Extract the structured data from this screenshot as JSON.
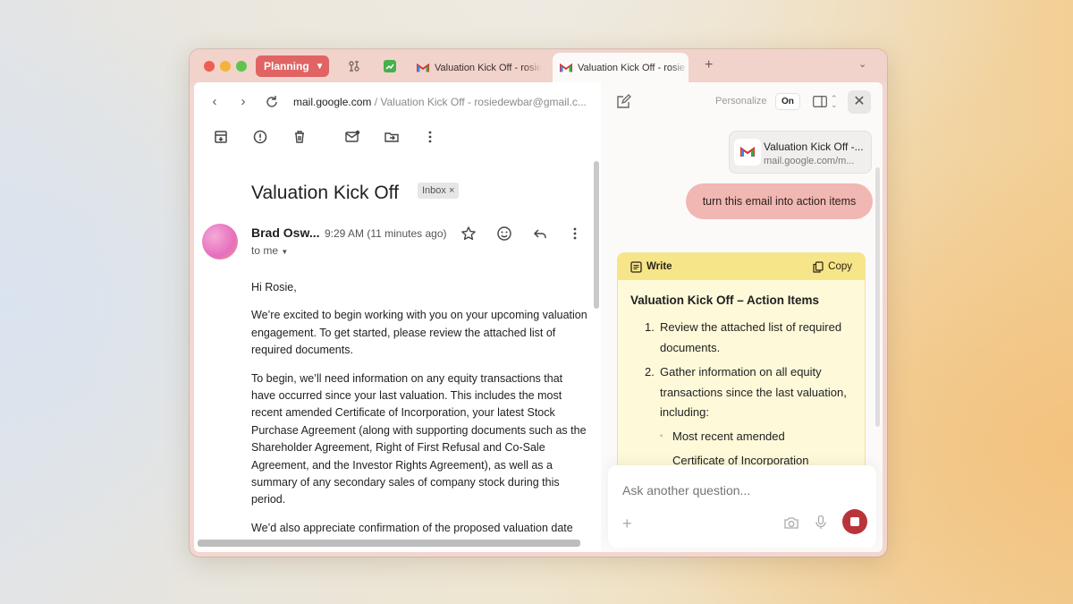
{
  "browser": {
    "space_label": "Planning",
    "tabs": [
      {
        "title": "Valuation Kick Off - rosie",
        "icon": "gmail-icon"
      },
      {
        "title": "Valuation Kick Off - rosie",
        "icon": "gmail-icon",
        "active": true
      }
    ],
    "url_host": "mail.google.com",
    "url_rest": " / Valuation Kick Off - rosiedewbar@gmail.c..."
  },
  "email": {
    "subject": "Valuation Kick Off",
    "label": "Inbox",
    "sender": "Brad Osw...",
    "time": "9:29 AM (11 minutes ago)",
    "to": "to me",
    "paragraphs": [
      "Hi Rosie,",
      "We’re excited to begin working with you on your upcoming valuation engagement. To get started, please review the attached list of required documents.",
      "To begin, we’ll need information on any equity transactions that have occurred since your last valuation. This includes the most recent amended Certificate of Incorporation, your latest Stock Purchase Agreement (along with supporting documents such as the Shareholder Agreement, Right of First Refusal and Co-Sale Agreement, and the Investor Rights Agreement), as well as a summary of any secondary sales of company stock during this period.",
      "We’d also appreciate confirmation of the proposed valuation date"
    ]
  },
  "assistant": {
    "personalize_label": "Personalize",
    "personalize_state": "On",
    "context_title": "Valuation Kick Off -...",
    "context_url": "mail.google.com/m...",
    "user_prompt": "turn this email into action items",
    "write_label": "Write",
    "copy_label": "Copy",
    "response_title": "Valuation Kick Off – Action Items",
    "items": [
      {
        "num": "1.",
        "text": "Review the attached list of required documents."
      },
      {
        "num": "2.",
        "text": "Gather information on all equity transactions since the last valuation, including:"
      }
    ],
    "subitems": [
      "Most recent amended",
      "Certificate of Incorporation"
    ],
    "ask_placeholder": "Ask another question..."
  },
  "colors": {
    "space_pill": "#e06464",
    "user_bubble": "#f1b7b2",
    "ai_header": "#f7e58a",
    "stop_button": "#b9343a"
  }
}
